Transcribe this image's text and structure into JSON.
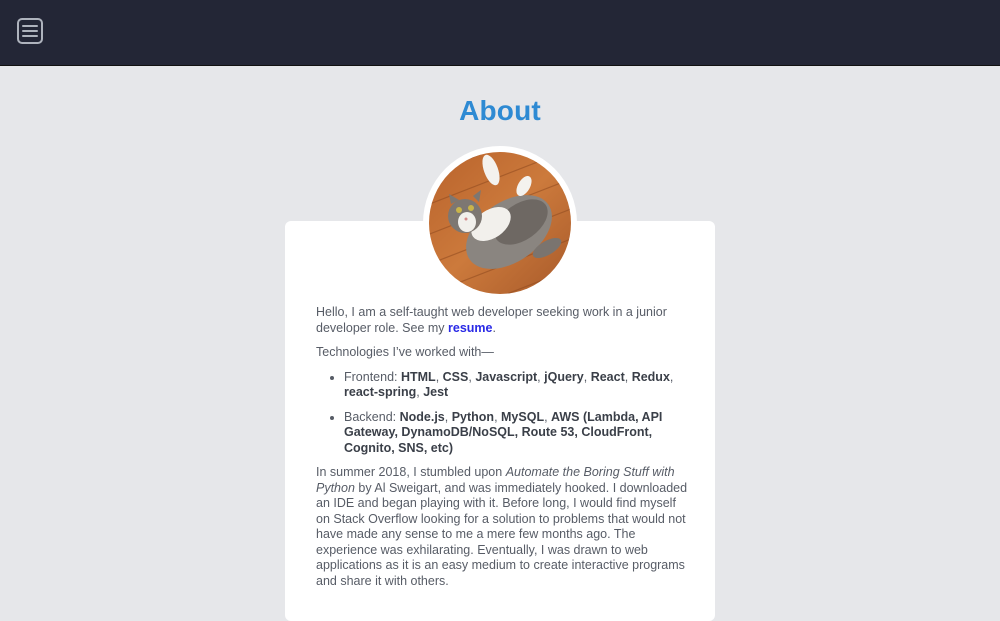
{
  "header": {
    "menu_icon": "hamburger-menu-icon"
  },
  "page": {
    "title": "About"
  },
  "avatar": {
    "alt": "cat lying on wooden floor"
  },
  "intro": {
    "text_before": "Hello, I am a self-taught web developer seeking work in a junior developer role. See my ",
    "resume_link": "resume",
    "text_after": "."
  },
  "tech": {
    "heading": "Technologies I’ve worked with—",
    "frontend": {
      "label": "Frontend: ",
      "items": [
        "HTML",
        "CSS",
        "Javascript",
        "jQuery",
        "React",
        "Redux",
        "react-spring",
        "Jest"
      ]
    },
    "backend": {
      "label": "Backend: ",
      "items": [
        "Node.js",
        "Python",
        "MySQL",
        "AWS (Lambda, API Gateway, DynamoDB/NoSQL, Route 53, CloudFront, Cognito, SNS, etc)"
      ]
    }
  },
  "story": {
    "text_before": "In summer 2018, I stumbled upon ",
    "book_title": "Automate the Boring Stuff with Python",
    "text_after": " by Al Sweigart, and was immediately hooked. I downloaded an IDE and began playing with it. Before long, I would find myself on Stack Overflow looking for a solution to problems that would not have made any sense to me a mere few months ago. The experience was exhilarating. Eventually, I was drawn to web applications as it is an easy medium to create interactive programs and share it with others."
  },
  "colors": {
    "topbar": "#232636",
    "title": "#2e8ad3",
    "link": "#2929e6",
    "background": "#e6e7ea"
  }
}
